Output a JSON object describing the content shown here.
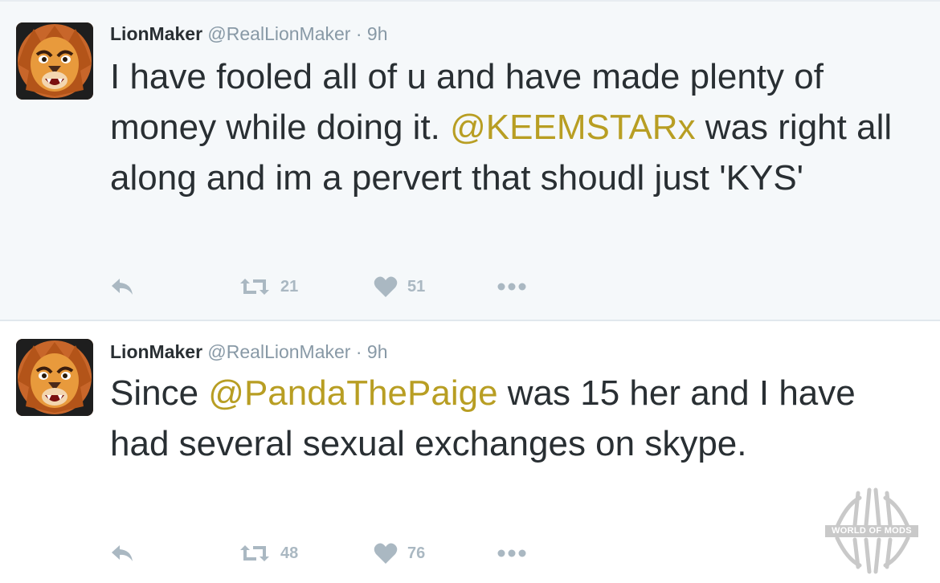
{
  "tweets": [
    {
      "name": "LionMaker",
      "handle": "@RealLionMaker",
      "separator": "·",
      "time": "9h",
      "text_parts": [
        "I have fooled all of u and have made plenty of money while doing it. ",
        "@KEEMSTARx",
        " was right all along and im a pervert that shoudl just 'KYS'"
      ],
      "retweets": "21",
      "likes": "51"
    },
    {
      "name": "LionMaker",
      "handle": "@RealLionMaker",
      "separator": "·",
      "time": "9h",
      "text_parts": [
        "Since ",
        "@PandaThePaige",
        " was 15 her and I have had several sexual exchanges on skype."
      ],
      "retweets": "48",
      "likes": "76"
    }
  ],
  "icons": {
    "reply": "reply-icon",
    "retweet": "retweet-icon",
    "like": "heart-icon",
    "more": "more-icon",
    "avatar": "lion-avatar"
  },
  "watermark": {
    "label": "WORLD OF MODS"
  },
  "colors": {
    "mention": "#b89e23",
    "muted": "#8899a6",
    "action": "#aab8c2",
    "text": "#292f33",
    "highlight_bg": "#f5f8fa"
  }
}
